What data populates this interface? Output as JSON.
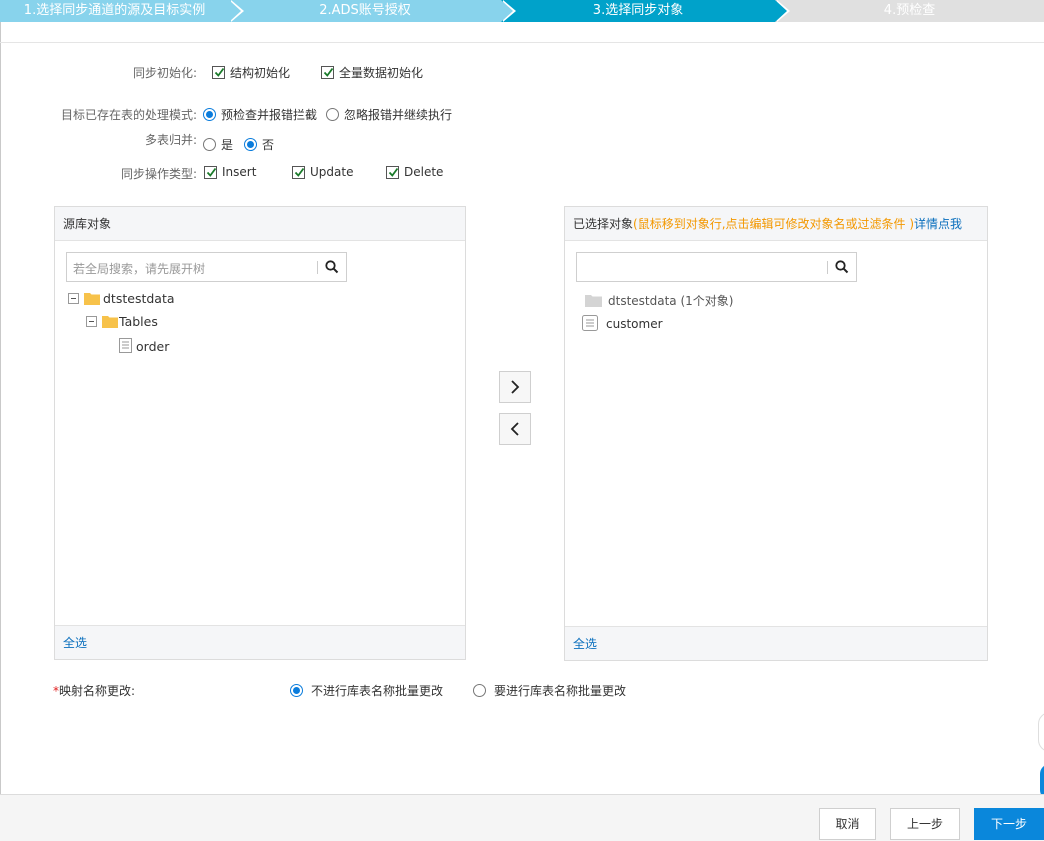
{
  "steps": [
    {
      "label": "1.选择同步通道的源及目标实例",
      "state": "done"
    },
    {
      "label": "2.ADS账号授权",
      "state": "done"
    },
    {
      "label": "3.选择同步对象",
      "state": "active"
    },
    {
      "label": "4.预检查",
      "state": "todo"
    }
  ],
  "form": {
    "sync_init_label": "同步初始化:",
    "struct_init": "结构初始化",
    "full_data_init": "全量数据初始化",
    "existing_table_label": "目标已存在表的处理模式:",
    "precheck_block": "预检查并报错拦截",
    "ignore_continue": "忽略报错并继续执行",
    "multi_merge_label": "多表归并:",
    "yes": "是",
    "no": "否",
    "op_type_label": "同步操作类型:",
    "insert": "Insert",
    "update": "Update",
    "delete": "Delete"
  },
  "source_panel": {
    "title": "源库对象",
    "search_placeholder": "若全局搜索，请先展开树",
    "tree": {
      "db": "dtstestdata",
      "folder": "Tables",
      "table": "order"
    },
    "select_all": "全选"
  },
  "target_panel": {
    "title": "已选择对象",
    "hint": "(鼠标移到对象行,点击编辑可修改对象名或过滤条件 )",
    "detail_link": "详情点我",
    "db": "dtstestdata (1个对象)",
    "table": "customer",
    "select_all": "全选"
  },
  "mapping": {
    "required_mark": "*",
    "label": "映射名称更改:",
    "opt_no": "不进行库表名称批量更改",
    "opt_yes": "要进行库表名称批量更改"
  },
  "footer": {
    "cancel": "取消",
    "prev": "上一步",
    "next": "下一步"
  },
  "colors": {
    "step_done": "#88d3ec",
    "step_active": "#00a2ca",
    "primary": "#0a87db",
    "hint_orange": "#f39800",
    "link_blue": "#0a6fbd"
  }
}
